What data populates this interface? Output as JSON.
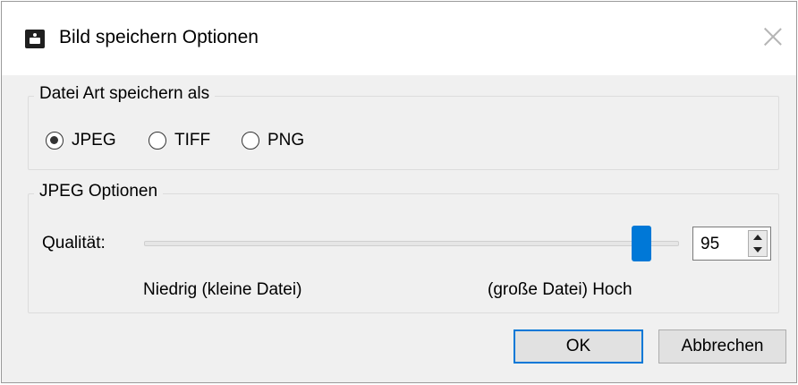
{
  "window": {
    "title": "Bild speichern Optionen",
    "icon": "image-icon"
  },
  "file_type_group": {
    "legend": "Datei Art speichern als",
    "options": [
      {
        "label": "JPEG",
        "checked": true
      },
      {
        "label": "TIFF",
        "checked": false
      },
      {
        "label": "PNG",
        "checked": false
      }
    ]
  },
  "jpeg_group": {
    "legend": "JPEG Optionen",
    "quality_label": "Qualität:",
    "quality_value": "95",
    "quality_percent": 95,
    "low_label": "Niedrig (kleine Datei)",
    "high_label": "(große Datei) Hoch"
  },
  "buttons": {
    "ok": "OK",
    "cancel": "Abbrechen"
  },
  "colors": {
    "accent": "#0078d7",
    "background": "#f0f0f0"
  }
}
